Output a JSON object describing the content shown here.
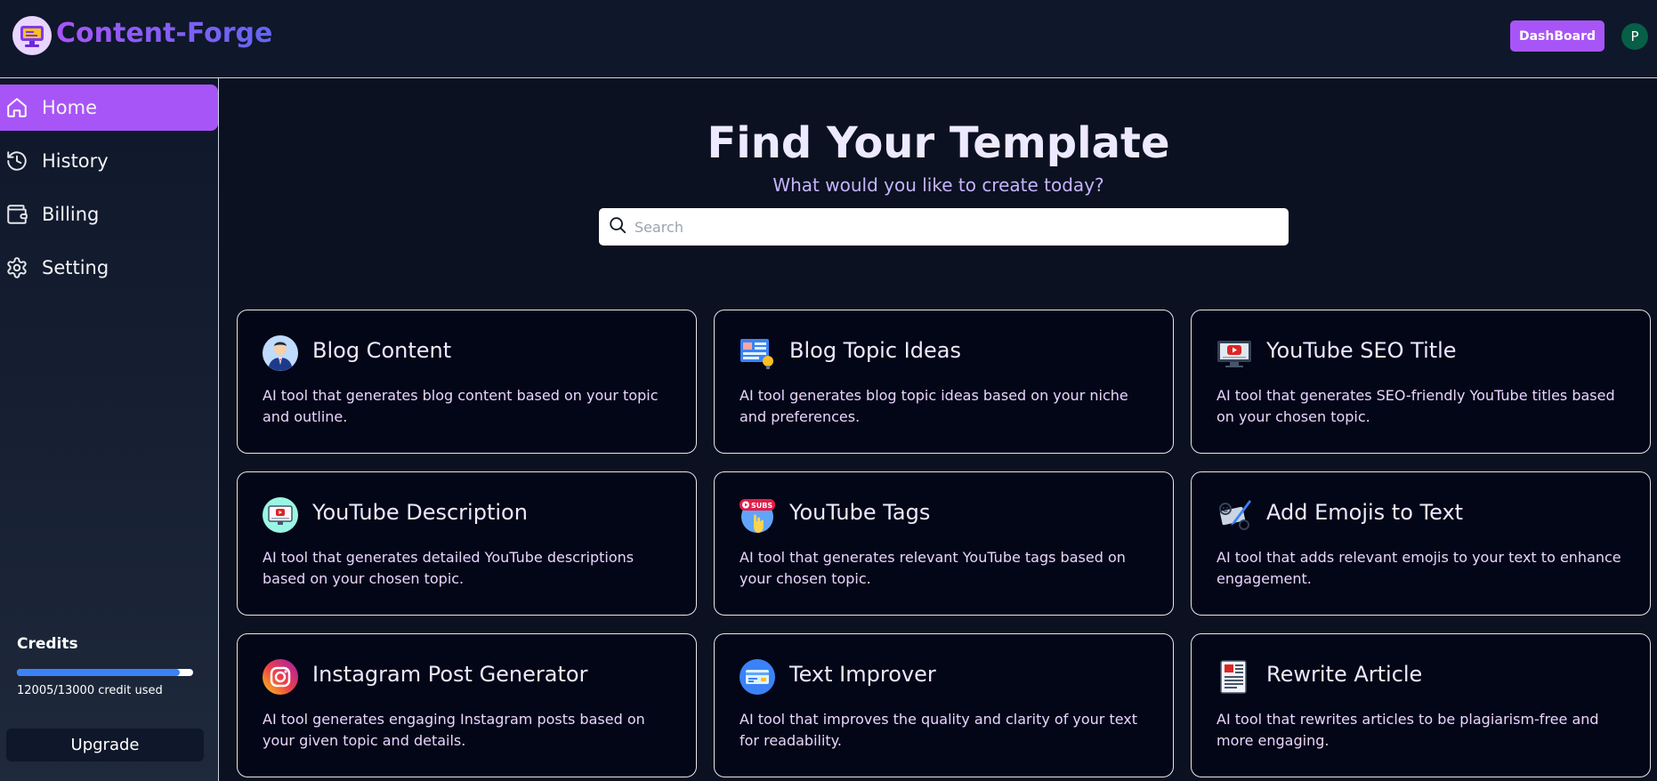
{
  "header": {
    "brand": "Content-Forge",
    "dashboard_label": "DashBoard",
    "avatar_initial": "P"
  },
  "sidebar": {
    "items": [
      {
        "label": "Home",
        "icon": "home-icon",
        "active": true
      },
      {
        "label": "History",
        "icon": "history-icon",
        "active": false
      },
      {
        "label": "Billing",
        "icon": "wallet-icon",
        "active": false
      },
      {
        "label": "Setting",
        "icon": "gear-icon",
        "active": false
      }
    ],
    "credits": {
      "title": "Credits",
      "used": 12005,
      "total": 13000,
      "text": "12005/13000 credit used"
    },
    "upgrade_label": "Upgrade"
  },
  "main": {
    "title": "Find Your Template",
    "subtitle": "What would you like to create today?",
    "search_placeholder": "Search",
    "templates": [
      {
        "title": "Blog Content",
        "desc": "AI tool that generates blog content based on your topic and outline.",
        "icon": "person-avatar-icon"
      },
      {
        "title": "Blog Topic Ideas",
        "desc": "AI tool generates blog topic ideas based on your niche and preferences.",
        "icon": "idea-board-icon"
      },
      {
        "title": "YouTube SEO Title",
        "desc": "AI tool that generates SEO-friendly YouTube titles based on your chosen topic.",
        "icon": "monitor-play-icon"
      },
      {
        "title": "YouTube Description",
        "desc": "AI tool that generates detailed YouTube descriptions based on your chosen topic.",
        "icon": "video-screen-icon"
      },
      {
        "title": "YouTube Tags",
        "desc": "AI tool that generates relevant YouTube tags based on your chosen topic.",
        "icon": "subscribe-icon"
      },
      {
        "title": "Add Emojis to Text",
        "desc": "AI tool that adds relevant emojis to your text to enhance engagement.",
        "icon": "emoji-pen-icon"
      },
      {
        "title": "Instagram Post Generator",
        "desc": "AI tool generates engaging Instagram posts based on your given topic and details.",
        "icon": "instagram-icon"
      },
      {
        "title": "Text Improver",
        "desc": "AI tool that improves the quality and clarity of your text for readability.",
        "icon": "card-text-icon"
      },
      {
        "title": "Rewrite Article",
        "desc": "AI tool that rewrites articles to be plagiarism-free and more engaging.",
        "icon": "newspaper-icon"
      }
    ]
  },
  "colors": {
    "accent": "#a855f7",
    "progress": "#3b82f6",
    "background": "#0b1120"
  }
}
